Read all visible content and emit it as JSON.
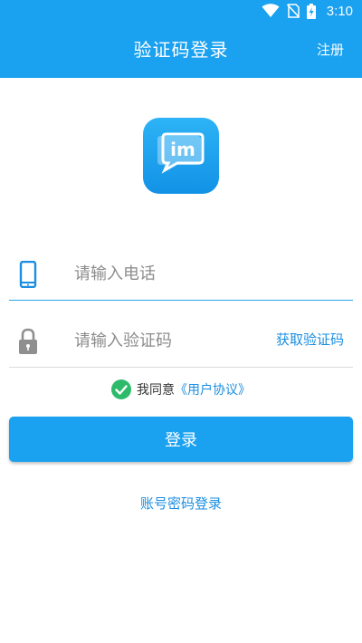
{
  "status_bar": {
    "time": "3:10",
    "icons": [
      "wifi-icon",
      "no-sim-icon",
      "battery-charging-icon"
    ]
  },
  "app_bar": {
    "title": "验证码登录",
    "register_label": "注册"
  },
  "logo": {
    "text": "im",
    "icon": "im-chat-logo"
  },
  "phone_field": {
    "icon": "phone-icon",
    "placeholder": "请输入电话",
    "value": ""
  },
  "code_field": {
    "icon": "lock-icon",
    "placeholder": "请输入验证码",
    "value": "",
    "get_code_label": "获取验证码"
  },
  "agreement": {
    "checked": true,
    "prefix": "我同意",
    "link": "《用户协议》"
  },
  "login_button": "登录",
  "account_login_link": "账号密码登录",
  "colors": {
    "primary": "#1aa1f0",
    "link": "#1a8ee0",
    "check_green": "#2dbb6b"
  }
}
